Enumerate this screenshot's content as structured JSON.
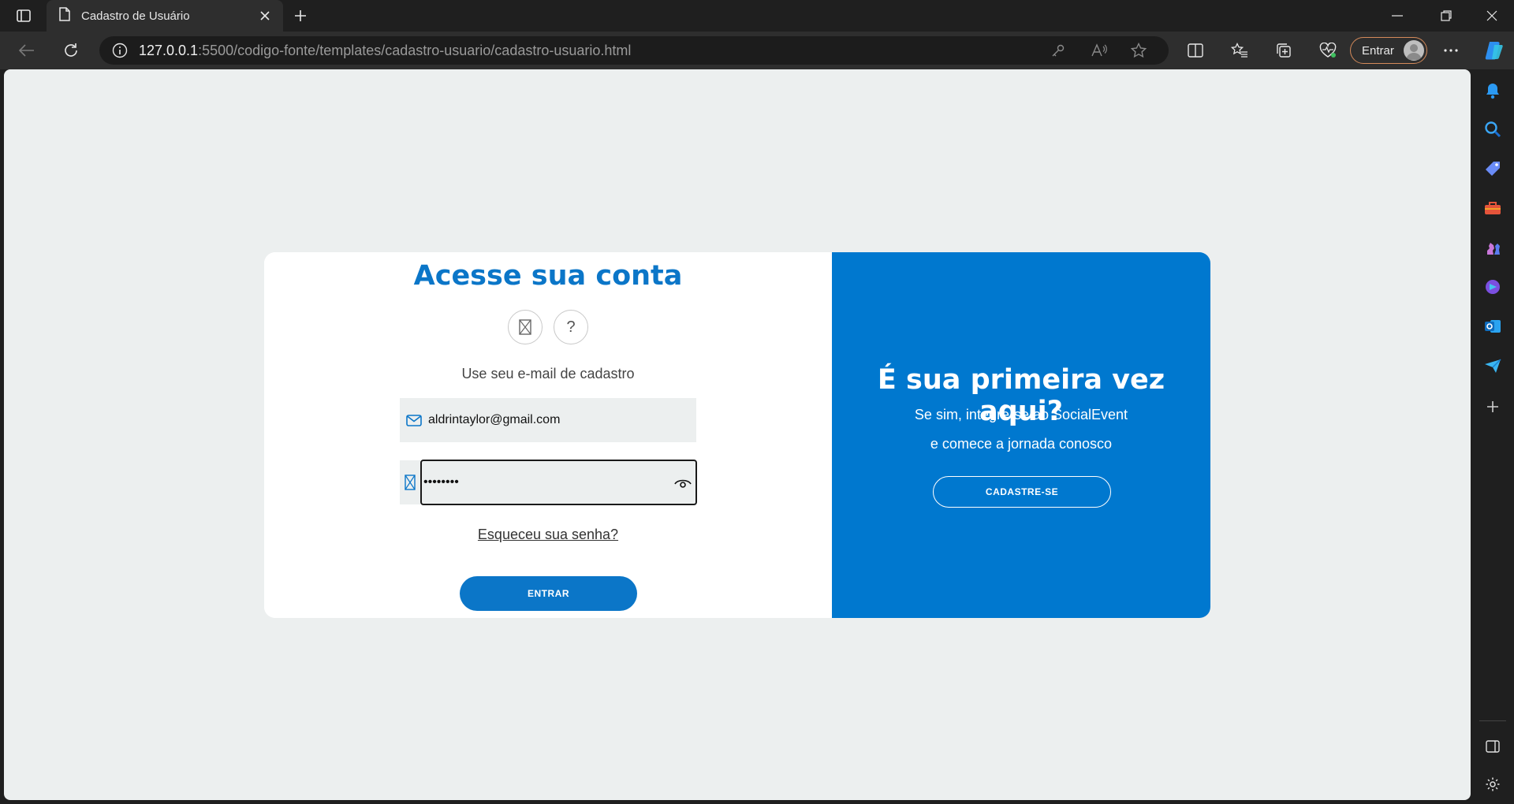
{
  "browser": {
    "tab": {
      "title": "Cadastro de Usuário"
    },
    "address": {
      "host": "127.0.0.1",
      "path": ":5500/codigo-fonte/templates/cadastro-usuario/cadastro-usuario.html"
    },
    "signin_label": "Entrar",
    "colors": {
      "accent": "#d48a5a",
      "chrome": "#1f1f1f",
      "toolbar": "#2e2e2e"
    }
  },
  "sidebar_icons": [
    "bell-icon",
    "search-icon",
    "tag-icon",
    "toolbox-icon",
    "chess-icon",
    "copilot-icon",
    "outlook-icon",
    "send-icon",
    "add-icon",
    "split-panel-icon",
    "settings-icon"
  ],
  "login": {
    "title": "Acesse sua conta",
    "social_icons": [
      "broken-image-icon",
      "question-icon"
    ],
    "social_second_glyph": "?",
    "hint": "Use seu e-mail de cadastro",
    "email_value": "aldrintaylor@gmail.com",
    "password_masked": "••••••••",
    "forgot": "Esqueceu sua senha?",
    "submit": "ENTRAR"
  },
  "welcome": {
    "title": "É sua primeira vez aqui?",
    "line1": "Se sim, integre-se ao SocialEvent",
    "line2": "e comece a jornada conosco",
    "signup": "CADASTRE-SE"
  },
  "colors": {
    "primary": "#0b76c8",
    "panel": "#0078cf",
    "page_bg": "#ecefef",
    "field_bg": "#ecefef"
  }
}
